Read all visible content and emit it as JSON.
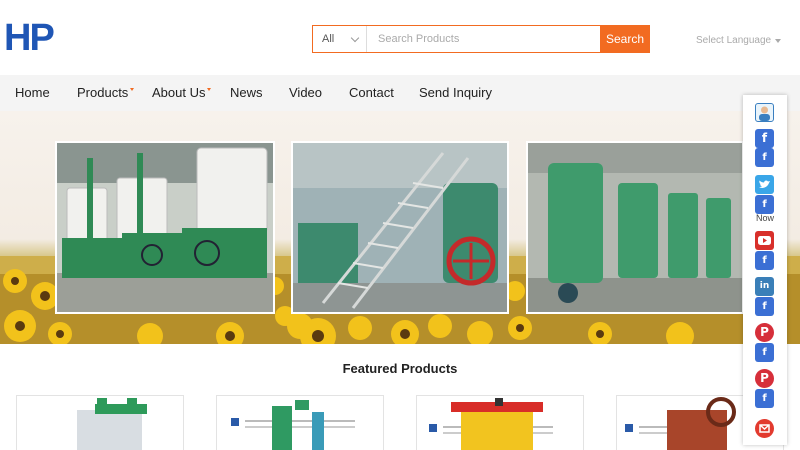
{
  "logo": {
    "text": "HP"
  },
  "search": {
    "category": "All",
    "placeholder": "Search Products",
    "button_label": "Search"
  },
  "language": {
    "label": "Select Language"
  },
  "nav": {
    "items": [
      {
        "label": "Home",
        "has_dropdown": false
      },
      {
        "label": "Products",
        "has_dropdown": true
      },
      {
        "label": "About Us",
        "has_dropdown": true
      },
      {
        "label": "News",
        "has_dropdown": false
      },
      {
        "label": "Video",
        "has_dropdown": false
      },
      {
        "label": "Contact",
        "has_dropdown": false
      },
      {
        "label": "Send Inquiry",
        "has_dropdown": false
      }
    ]
  },
  "featured": {
    "title": "Featured Products"
  },
  "social": {
    "items": [
      {
        "icon": "avatar-icon"
      },
      {
        "icon": "facebook-icon"
      },
      {
        "icon": "facebook-share-icon"
      },
      {
        "icon": "twitter-icon"
      },
      {
        "icon": "facebook-share-icon"
      },
      {
        "icon": "youtube-icon"
      },
      {
        "icon": "facebook-share-icon"
      },
      {
        "icon": "linkedin-icon"
      },
      {
        "icon": "facebook-share-icon"
      },
      {
        "icon": "pinterest-icon"
      },
      {
        "icon": "facebook-share-icon"
      },
      {
        "icon": "pinterest-icon"
      },
      {
        "icon": "facebook-share-icon"
      },
      {
        "icon": "email-icon"
      }
    ],
    "now_label": "Now"
  },
  "colors": {
    "accent": "#f26b21",
    "logo": "#1f56b5",
    "nav_bg": "#f4f4f4",
    "facebook": "#3b6fd4",
    "twitter": "#3aa6e8",
    "youtube": "#d8302b",
    "pinterest": "#d62f3a"
  }
}
